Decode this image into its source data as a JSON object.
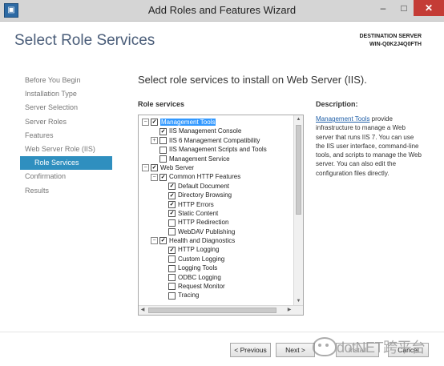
{
  "window": {
    "title": "Add Roles and Features Wizard",
    "icon_name": "server-manager-icon",
    "controls": {
      "minimize": "–",
      "maximize": "□",
      "close": "✕"
    }
  },
  "page_title": "Select Role Services",
  "destination": {
    "label": "DESTINATION SERVER",
    "value": "WIN-Q0K2J4Q0FTH"
  },
  "nav": {
    "items": [
      {
        "label": "Before You Begin"
      },
      {
        "label": "Installation Type"
      },
      {
        "label": "Server Selection"
      },
      {
        "label": "Server Roles"
      },
      {
        "label": "Features"
      },
      {
        "label": "Web Server Role (IIS)"
      },
      {
        "label": "Role Services"
      },
      {
        "label": "Confirmation"
      },
      {
        "label": "Results"
      }
    ]
  },
  "main": {
    "heading": "Select role services to install on Web Server (IIS).",
    "role_services_label": "Role services",
    "tree": [
      {
        "label": "Management Tools",
        "expander": "⊟",
        "checked": true,
        "selected": true
      },
      {
        "label": "IIS Management Console",
        "expander": "",
        "checked": true
      },
      {
        "label": "IIS 6 Management Compatibility",
        "expander": "⊞",
        "checked": false
      },
      {
        "label": "IIS Management Scripts and Tools",
        "expander": "",
        "checked": false
      },
      {
        "label": "Management Service",
        "expander": "",
        "checked": false
      },
      {
        "label": "Web Server",
        "expander": "⊟",
        "checked": true
      },
      {
        "label": "Common HTTP Features",
        "expander": "⊟",
        "checked": true
      },
      {
        "label": "Default Document",
        "expander": "",
        "checked": true
      },
      {
        "label": "Directory Browsing",
        "expander": "",
        "checked": true
      },
      {
        "label": "HTTP Errors",
        "expander": "",
        "checked": true
      },
      {
        "label": "Static Content",
        "expander": "",
        "checked": true
      },
      {
        "label": "HTTP Redirection",
        "expander": "",
        "checked": false
      },
      {
        "label": "WebDAV Publishing",
        "expander": "",
        "checked": false
      },
      {
        "label": "Health and Diagnostics",
        "expander": "⊟",
        "checked": true
      },
      {
        "label": "HTTP Logging",
        "expander": "",
        "checked": true
      },
      {
        "label": "Custom Logging",
        "expander": "",
        "checked": false
      },
      {
        "label": "Logging Tools",
        "expander": "",
        "checked": false
      },
      {
        "label": "ODBC Logging",
        "expander": "",
        "checked": false
      },
      {
        "label": "Request Monitor",
        "expander": "",
        "checked": false
      },
      {
        "label": "Tracing",
        "expander": "",
        "checked": false
      }
    ],
    "tree_scroll": {
      "up": "▲",
      "down": "▼",
      "left": "◀",
      "right": "▶"
    }
  },
  "description": {
    "label": "Description:",
    "link": "Management Tools",
    "text": " provide infrastructure to manage a Web server that runs IIS 7. You can use the IIS user interface, command-line tools, and scripts to manage the Web server. You can also edit the configuration files directly."
  },
  "buttons": {
    "previous": "< Previous",
    "next": "Next >",
    "install": "Install",
    "cancel": "Cancel"
  },
  "watermark": {
    "text": "dotNET跨平台"
  },
  "colors": {
    "nav_active": "#2f8fbf",
    "title_blue": "#4a5d79",
    "selection": "#3399ff"
  }
}
